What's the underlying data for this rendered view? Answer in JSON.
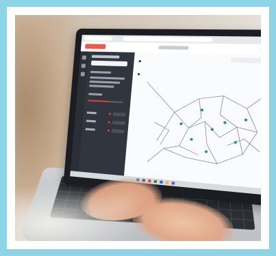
{
  "scene": {
    "description_icon": "laptop-icon",
    "frame_color": "#8fd3e6"
  },
  "colors": {
    "accent": "#e2412f",
    "sidebar": "#31363e",
    "screen_bg": "#f4f5f7",
    "map_lines": "#6f7784",
    "map_points": "#1f8f8a"
  }
}
